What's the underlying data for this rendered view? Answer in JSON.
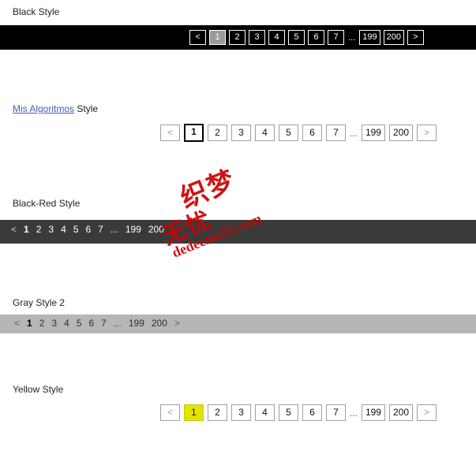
{
  "sections": [
    {
      "id": "black",
      "title_prefix": "",
      "title_link": "",
      "title": "Black Style",
      "pager": {
        "prev": "<",
        "next": ">",
        "ellipsis": "...",
        "pages": [
          "1",
          "2",
          "3",
          "4",
          "5",
          "6",
          "7"
        ],
        "tail_pages": [
          "199",
          "200"
        ],
        "current": "1"
      }
    },
    {
      "id": "algo",
      "title_link": "Mis Algoritmos",
      "title_suffix": " Style",
      "pager": {
        "prev": "<",
        "next": ">",
        "ellipsis": "...",
        "pages": [
          "1",
          "2",
          "3",
          "4",
          "5",
          "6",
          "7"
        ],
        "tail_pages": [
          "199",
          "200"
        ],
        "current": "1"
      }
    },
    {
      "id": "blackred",
      "title": "Black-Red Style",
      "pager": {
        "prev": "<",
        "next": "",
        "ellipsis": "...",
        "pages": [
          "1",
          "2",
          "3",
          "4",
          "5",
          "6",
          "7"
        ],
        "tail_pages": [
          "199",
          "200"
        ],
        "current": "1"
      }
    },
    {
      "id": "gray",
      "title": "Gray Style 2",
      "pager": {
        "prev": "<",
        "next": ">",
        "ellipsis": "...",
        "pages": [
          "1",
          "2",
          "3",
          "4",
          "5",
          "6",
          "7"
        ],
        "tail_pages": [
          "199",
          "200"
        ],
        "current": "1"
      }
    },
    {
      "id": "yellow",
      "title": "Yellow Style",
      "pager": {
        "prev": "<",
        "next": ">",
        "ellipsis": "...",
        "pages": [
          "1",
          "2",
          "3",
          "4",
          "5",
          "6",
          "7"
        ],
        "tail_pages": [
          "199",
          "200"
        ],
        "current": "1"
      }
    }
  ],
  "watermark": {
    "line1": "织梦",
    "line2": "无忧",
    "url": "dedecms51.com"
  },
  "colors": {
    "black_bar": "#000000",
    "blackred_bar": "#3a3a3a",
    "gray_bar": "#b6b6b6",
    "yellow_current": "#e3e300",
    "link": "#3b5fbe",
    "watermark": "#cc0000"
  }
}
